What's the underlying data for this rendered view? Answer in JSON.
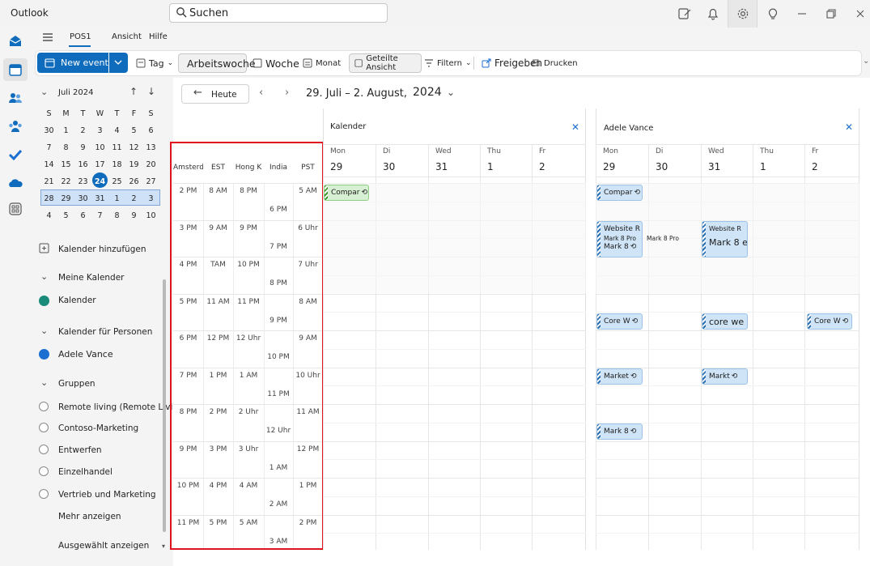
{
  "app": {
    "title": "Outlook"
  },
  "search": {
    "placeholder": "Suchen"
  },
  "menu": {
    "tabs": [
      "POS1",
      "Ansicht",
      "Hilfe"
    ]
  },
  "ribbon": {
    "new_event": "New event",
    "day": "Tag",
    "workweek": "Arbeitswoche",
    "week": "Woche",
    "month": "Monat",
    "split": "Geteilte Ansicht",
    "filter": "Filtern",
    "share": "Freigeben",
    "print": "Drucken"
  },
  "mini_cal": {
    "month_label": "Juli 2024",
    "weekdays": [
      "S",
      "M",
      "T",
      "W",
      "T",
      "F",
      "S"
    ],
    "weeks": [
      [
        "30",
        "1",
        "2",
        "3",
        "4",
        "5",
        "6"
      ],
      [
        "7",
        "8",
        "9",
        "10",
        "11",
        "12",
        "13"
      ],
      [
        "14",
        "15",
        "16",
        "17",
        "18",
        "19",
        "20"
      ],
      [
        "21",
        "22",
        "23",
        "24",
        "25",
        "26",
        "27"
      ],
      [
        "28",
        "29",
        "30",
        "31",
        "1",
        "2",
        "3"
      ],
      [
        "4",
        "5",
        "6",
        "7",
        "8",
        "9",
        "10"
      ]
    ],
    "today": "24"
  },
  "sidebar": {
    "add_calendar": "Kalender hinzufügen",
    "my_calendars": "Meine Kalender",
    "calendar": "Kalender",
    "people_calendars": "Kalender für Personen",
    "adele": "Adele Vance",
    "groups": "Gruppen",
    "group_items": [
      "Remote living (Remote Living)",
      "Contoso-Marketing",
      "Entwerfen",
      "Einzelhandel",
      "Vertrieb und Marketing"
    ],
    "show_more": "Mehr anzeigen",
    "show_selected": "Ausgewählt anzeigen"
  },
  "nav": {
    "today": "Heute",
    "date_range": "29. Juli – 2. August,",
    "year": "2024"
  },
  "timezones": {
    "headers": [
      "Amsterd",
      "EST",
      "Hong K",
      "India",
      "PST"
    ],
    "amsterdam": [
      "2 PM",
      "3 PM",
      "4 PM",
      "5 PM",
      "6 PM",
      "7 PM",
      "8 PM",
      "9 PM",
      "10 PM",
      "11 PM"
    ],
    "est": [
      "8 AM",
      "9 AM",
      "TAM",
      "11 AM",
      "12 PM",
      "1 PM",
      "2 PM",
      "3 PM",
      "4 PM",
      "5 PM"
    ],
    "hongkong": [
      "8 PM",
      "9 PM",
      "10 PM",
      "11 PM",
      "12 Uhr",
      "1 AM",
      "2 Uhr",
      "3 Uhr",
      "4 AM",
      "5 AM"
    ],
    "india": [
      "6 PM",
      "7 PM",
      "8 PM",
      "9 PM",
      "10 PM",
      "11 PM",
      "12 Uhr",
      "1 AM",
      "2 AM",
      "3 AM"
    ],
    "pst": [
      "5 AM",
      "6 Uhr",
      "7 Uhr",
      "8 AM",
      "9 AM",
      "10 Uhr",
      "11 AM",
      "12 PM",
      "1 PM",
      "2 PM"
    ]
  },
  "panels": [
    {
      "title": "Kalender",
      "days": [
        {
          "name": "Mon",
          "num": "29"
        },
        {
          "name": "Di",
          "num": "30"
        },
        {
          "name": "Wed",
          "num": "31"
        },
        {
          "name": "Thu",
          "num": "1"
        },
        {
          "name": "Fr",
          "num": "2"
        }
      ],
      "events": [
        "Compar"
      ]
    },
    {
      "title": "Adele Vance",
      "days": [
        {
          "name": "Mon",
          "num": "29"
        },
        {
          "name": "Di",
          "num": "30"
        },
        {
          "name": "Wed",
          "num": "31"
        },
        {
          "name": "Thu",
          "num": "1"
        },
        {
          "name": "Fr",
          "num": "2"
        }
      ],
      "events": {
        "compar": "Compar",
        "website_mon_title": "Website R",
        "website_mon_sub": "Mark 8 Pro",
        "website_mon_line3": "Mark 8",
        "di_text": "Mark 8 Pro",
        "website_wed_title": "Website R",
        "website_wed_sub": "Mark 8 e",
        "core_mon": "Core W",
        "core_wed": "core we",
        "core_fri": "Core W",
        "market_mon": "Market",
        "market_wed": "Markt",
        "mark8_mon": "Mark 8"
      }
    }
  ],
  "recur_symbol": "⟲"
}
